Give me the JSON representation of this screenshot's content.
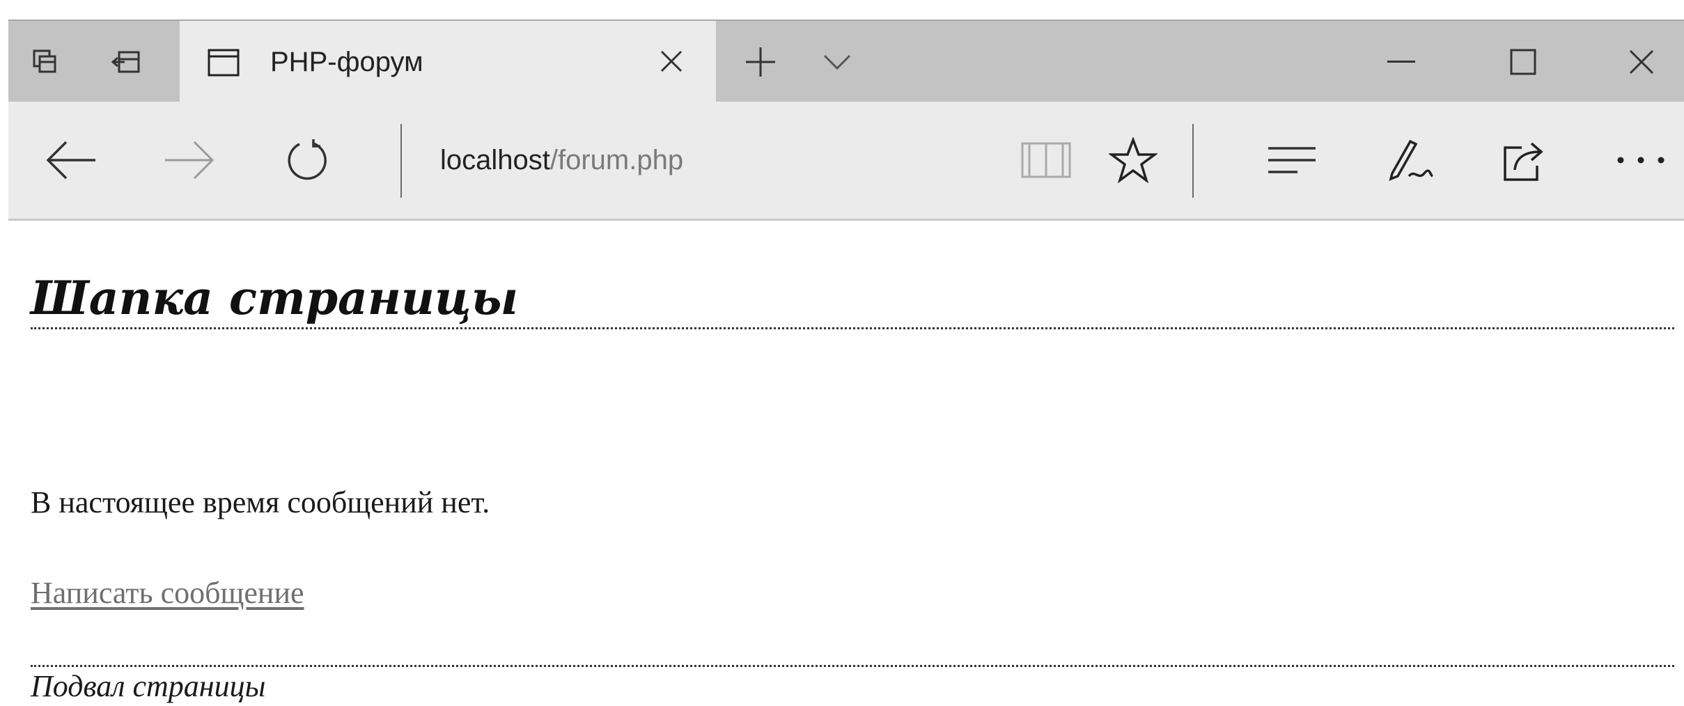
{
  "browser": {
    "tab": {
      "title": "PHP-форум",
      "icon": "page-icon"
    },
    "tabbar_icons": [
      "tab-preview-icon",
      "set-aside-tabs-icon",
      "new-tab-icon",
      "tab-list-chevron-icon"
    ],
    "window_controls": [
      "minimize-icon",
      "maximize-icon",
      "close-icon"
    ],
    "address": {
      "host": "localhost",
      "path": "/forum.php"
    },
    "nav_icons": [
      "back-arrow-icon",
      "forward-arrow-icon",
      "refresh-icon",
      "reading-view-icon",
      "favorites-star-icon",
      "hub-icon",
      "web-note-icon",
      "share-icon",
      "more-icon"
    ]
  },
  "page": {
    "header_title": "Шапка страницы",
    "empty_message": "В настоящее время сообщений нет.",
    "write_link": "Написать сообщение",
    "footer_text": "Подвал страницы"
  }
}
